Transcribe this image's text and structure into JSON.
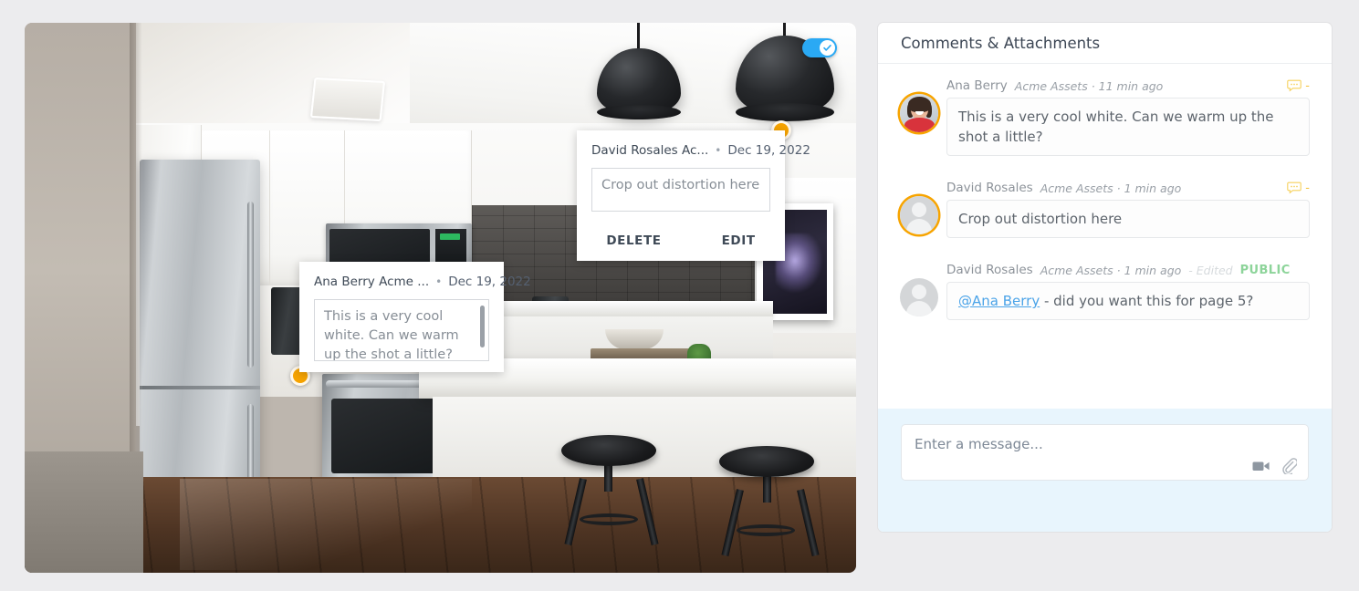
{
  "viewer": {
    "name": "kitchen-photo",
    "toggle": {
      "name": "annotations-toggle",
      "state": "on"
    },
    "markers": [
      {
        "id": "marker-1",
        "color": "#f7a400"
      },
      {
        "id": "marker-2",
        "color": "#f7a400"
      }
    ],
    "popups": [
      {
        "id": "popup-david",
        "author": "David Rosales Ac...",
        "separator": "•",
        "date": "Dec 19, 2022",
        "text": "Crop out distortion here",
        "delete_label": "DELETE",
        "edit_label": "EDIT"
      },
      {
        "id": "popup-ana",
        "author": "Ana Berry Acme ...",
        "separator": "•",
        "date": "Dec 19, 2022",
        "text": "This is a very cool white. Can we warm up the shot a little?"
      }
    ]
  },
  "panel": {
    "title": "Comments & Attachments",
    "comments": [
      {
        "author": "Ana Berry",
        "sub": "Acme Assets · 11 min ago",
        "edited": "",
        "visibility": "",
        "text": "This is a very cool white. Can we warm up the shot a little?",
        "mention": "",
        "avatar": "photo",
        "ringed": true,
        "caret": "-"
      },
      {
        "author": "David Rosales",
        "sub": "Acme Assets · 1 min ago",
        "edited": "",
        "visibility": "",
        "text": "Crop out distortion here",
        "mention": "",
        "avatar": "person",
        "ringed": true,
        "caret": "-"
      },
      {
        "author": "David Rosales",
        "sub": "Acme Assets · 1 min ago",
        "edited": "- Edited",
        "visibility": "PUBLIC",
        "text": " - did you want this for page 5?",
        "mention": "@Ana Berry",
        "avatar": "person",
        "ringed": false,
        "caret": ""
      }
    ],
    "composer": {
      "placeholder": "Enter a message...",
      "video_icon": "video-camera-icon",
      "attach_icon": "paperclip-icon"
    }
  },
  "colors": {
    "accent_orange": "#f7a400",
    "toggle_blue": "#2aa9f4",
    "public_green": "#8dd49a",
    "mention_blue": "#4aa3e8",
    "composer_bg": "#e8f5fd"
  }
}
